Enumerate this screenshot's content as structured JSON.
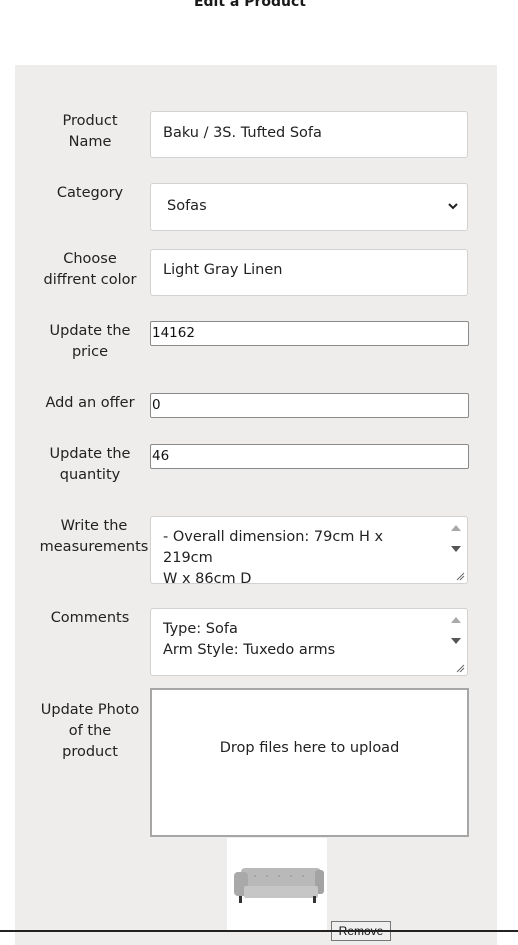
{
  "page": {
    "title": "Edit a Product"
  },
  "form": {
    "product_name": {
      "label": "Product Name",
      "value": "Baku / 3S. Tufted Sofa"
    },
    "category": {
      "label": "Category",
      "value": "Sofas"
    },
    "color": {
      "label": "Choose diffrent color",
      "value": "Light Gray Linen"
    },
    "price": {
      "label": "Update the price",
      "value": "14162"
    },
    "offer": {
      "label": "Add an offer",
      "value": "0"
    },
    "quantity": {
      "label": "Update the quantity",
      "value": "46"
    },
    "measurements": {
      "label": "Write the measurements",
      "lines": [
        "- Overall dimension: 79cm H x 219cm",
        "W x 86cm D"
      ]
    },
    "comments": {
      "label": "Comments",
      "lines": [
        "Type: Sofa",
        "Arm Style: Tuxedo arms"
      ]
    },
    "photo": {
      "label": "Update Photo of the product",
      "dropzone_text": "Drop files here to upload",
      "remove_label": "Remove"
    }
  },
  "icons": {
    "select": "chevron-down-icon",
    "scroll_up": "scroll-up-icon",
    "scroll_down": "scroll-down-icon",
    "resize": "resize-grip-icon"
  },
  "colors": {
    "panel": "#eeedeb",
    "field_border": "#d2d2d2"
  }
}
